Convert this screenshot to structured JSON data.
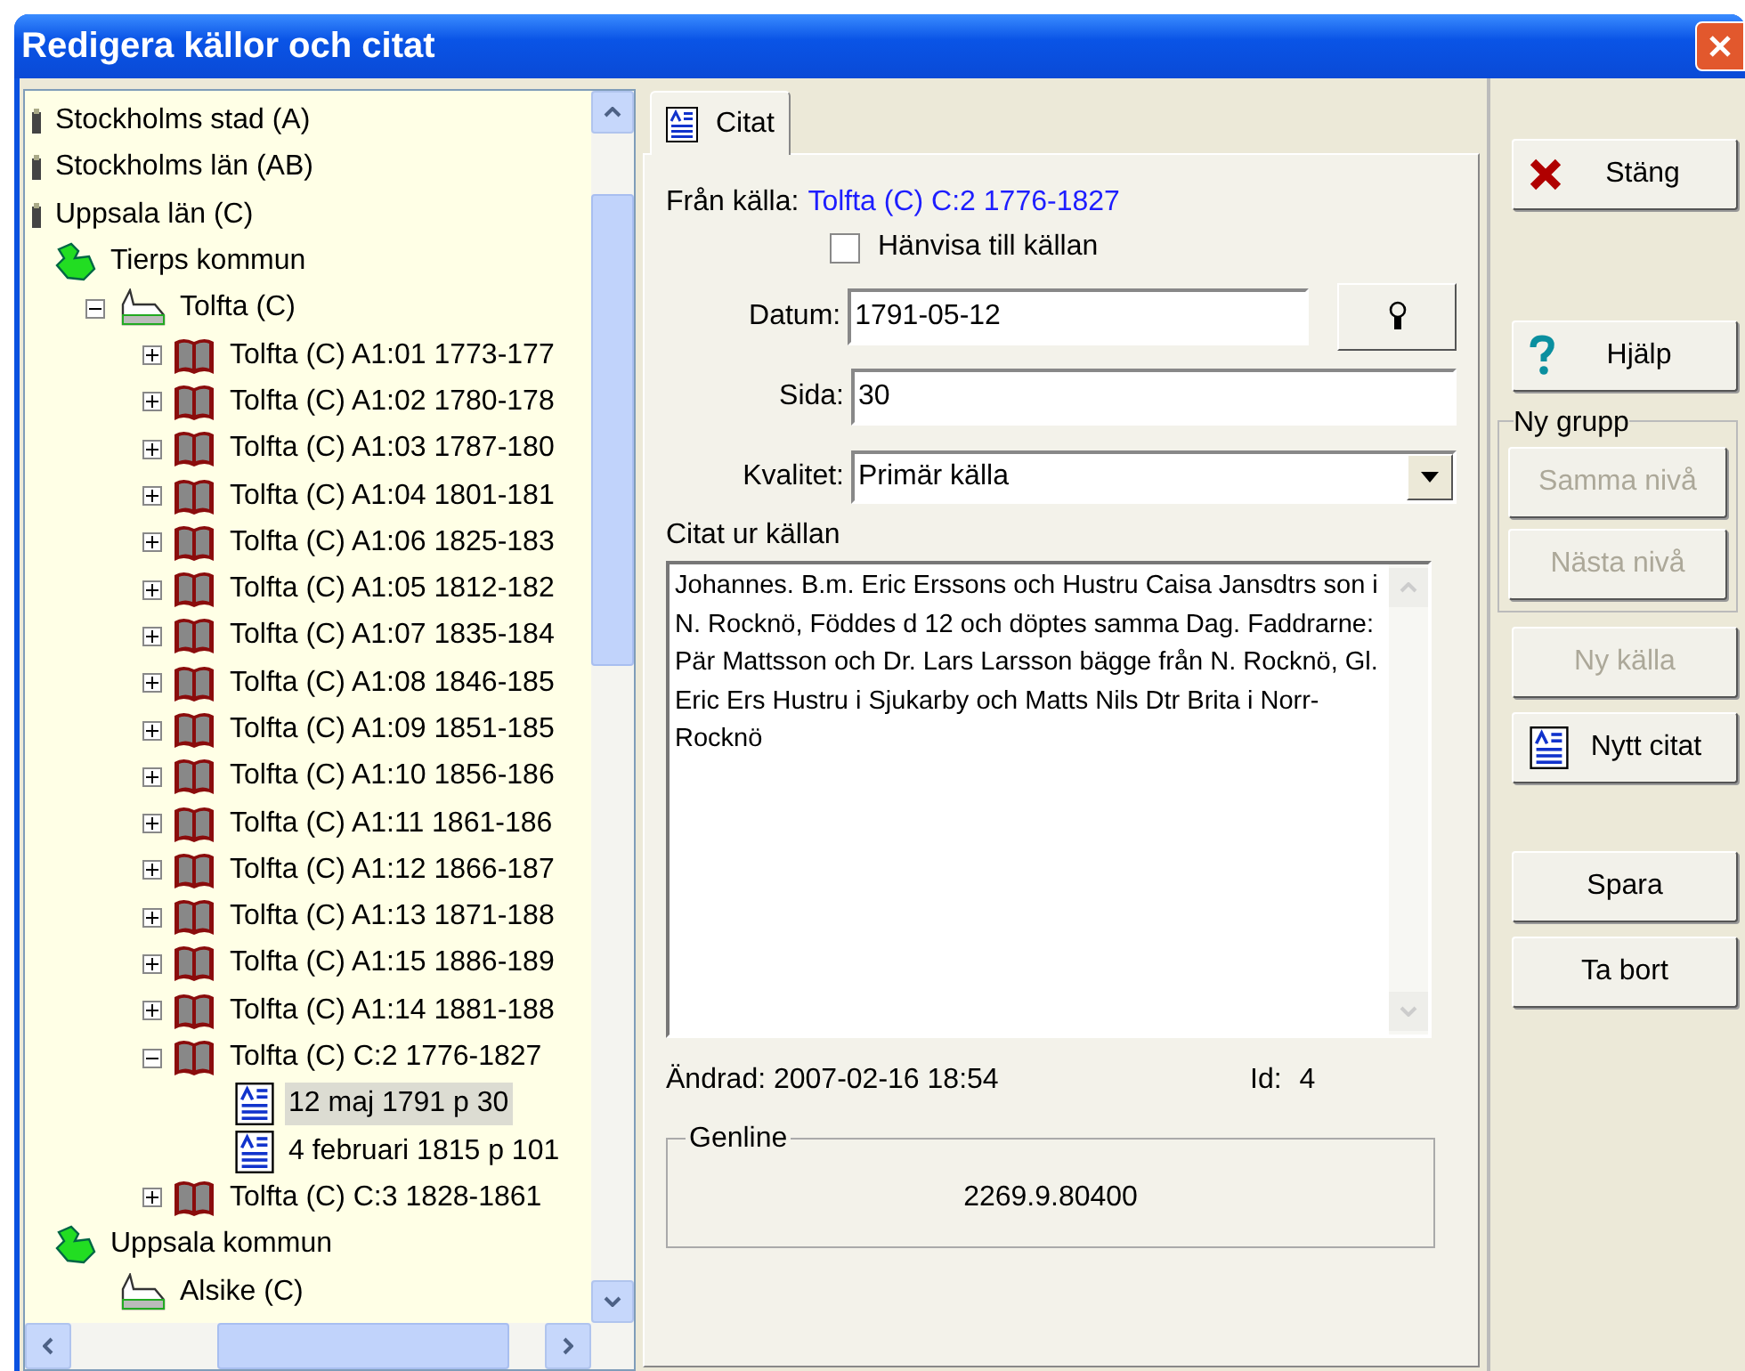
{
  "window": {
    "title": "Redigera källor och citat"
  },
  "tree": {
    "items": [
      {
        "kind": "county",
        "label": "Stockholms stad (A)",
        "selected": false
      },
      {
        "kind": "county",
        "label": "Stockholms län (AB)",
        "selected": false
      },
      {
        "kind": "county",
        "label": "Uppsala län (C)",
        "selected": false,
        "children": [
          {
            "kind": "municipality",
            "label": "Tierps kommun",
            "selected": false,
            "children": [
              {
                "kind": "parish",
                "label": "Tolfta (C)",
                "selected": false,
                "expanded": true,
                "children": [
                  {
                    "kind": "book",
                    "label": "Tolfta (C) A1:01 1773-177",
                    "selected": false,
                    "expanded": false
                  },
                  {
                    "kind": "book",
                    "label": "Tolfta (C) A1:02 1780-178",
                    "selected": false,
                    "expanded": false
                  },
                  {
                    "kind": "book",
                    "label": "Tolfta (C) A1:03 1787-180",
                    "selected": false,
                    "expanded": false
                  },
                  {
                    "kind": "book",
                    "label": "Tolfta (C) A1:04 1801-181",
                    "selected": false,
                    "expanded": false
                  },
                  {
                    "kind": "book",
                    "label": "Tolfta (C) A1:06 1825-183",
                    "selected": false,
                    "expanded": false
                  },
                  {
                    "kind": "book",
                    "label": "Tolfta (C) A1:05 1812-182",
                    "selected": false,
                    "expanded": false
                  },
                  {
                    "kind": "book",
                    "label": "Tolfta (C) A1:07 1835-184",
                    "selected": false,
                    "expanded": false
                  },
                  {
                    "kind": "book",
                    "label": "Tolfta (C) A1:08 1846-185",
                    "selected": false,
                    "expanded": false
                  },
                  {
                    "kind": "book",
                    "label": "Tolfta (C) A1:09 1851-185",
                    "selected": false,
                    "expanded": false
                  },
                  {
                    "kind": "book",
                    "label": "Tolfta (C) A1:10 1856-186",
                    "selected": false,
                    "expanded": false
                  },
                  {
                    "kind": "book",
                    "label": "Tolfta (C) A1:11 1861-186",
                    "selected": false,
                    "expanded": false
                  },
                  {
                    "kind": "book",
                    "label": "Tolfta (C) A1:12 1866-187",
                    "selected": false,
                    "expanded": false
                  },
                  {
                    "kind": "book",
                    "label": "Tolfta (C) A1:13 1871-188",
                    "selected": false,
                    "expanded": false
                  },
                  {
                    "kind": "book",
                    "label": "Tolfta (C) A1:15 1886-189",
                    "selected": false,
                    "expanded": false
                  },
                  {
                    "kind": "book",
                    "label": "Tolfta (C) A1:14 1881-188",
                    "selected": false,
                    "expanded": false
                  },
                  {
                    "kind": "book",
                    "label": "Tolfta (C) C:2 1776-1827",
                    "selected": false,
                    "expanded": true,
                    "children": [
                      {
                        "kind": "citation",
                        "label": "12 maj 1791 p 30",
                        "selected": true
                      },
                      {
                        "kind": "citation",
                        "label": "4 februari 1815 p 101",
                        "selected": false
                      }
                    ]
                  },
                  {
                    "kind": "book",
                    "label": "Tolfta (C) C:3 1828-1861",
                    "selected": false,
                    "expanded": false
                  }
                ]
              }
            ]
          },
          {
            "kind": "municipality",
            "label": "Uppsala kommun",
            "selected": false,
            "children": [
              {
                "kind": "parish",
                "label": "Alsike (C)",
                "selected": false
              }
            ]
          }
        ]
      }
    ]
  },
  "tabs": [
    {
      "label": "Citat",
      "selected": true
    }
  ],
  "form": {
    "source_label": "Från källa:",
    "source_value": "Tolfta (C) C:2 1776-1827",
    "refer_checkbox": {
      "label": "Hänvisa till källan",
      "checked": false
    },
    "date": {
      "label": "Datum:",
      "value": "1791-05-12"
    },
    "page": {
      "label": "Sida:",
      "value": "30"
    },
    "quality": {
      "label": "Kvalitet:",
      "value": "Primär källa"
    },
    "quote_label": "Citat ur källan",
    "quote": "Johannes. B.m. Eric Erssons och Hustru Caisa Jansdtrs son i N. Rocknö, Föddes d 12 och döptes samma Dag. Faddrarne: Pär Mattsson och Dr. Lars Larsson bägge från N. Rocknö, Gl. Eric Ers Hustru i Sjukarby och Matts Nils Dtr Brita i Norr-Rocknö",
    "changed": "Ändrad: 2007-02-16 18:54",
    "id_label": "Id:",
    "id_value": "4",
    "genline": {
      "title": "Genline",
      "value": "2269.9.80400"
    }
  },
  "buttons": {
    "close": {
      "label": "Stäng",
      "disabled": false
    },
    "help": {
      "label": "Hjälp",
      "disabled": false
    },
    "group_title": "Ny grupp",
    "group": [
      {
        "label": "Samma nivå",
        "disabled": true
      },
      {
        "label": "Nästa nivå",
        "disabled": true
      }
    ],
    "actions": [
      {
        "kind": "plain",
        "label": "Ny källa",
        "disabled": true
      },
      {
        "kind": "citation",
        "label": "Nytt citat",
        "disabled": false
      },
      {
        "kind": "spacer_plain",
        "label": "Spara",
        "disabled": false
      },
      {
        "kind": "plain",
        "label": "Ta bort",
        "disabled": false
      }
    ]
  }
}
